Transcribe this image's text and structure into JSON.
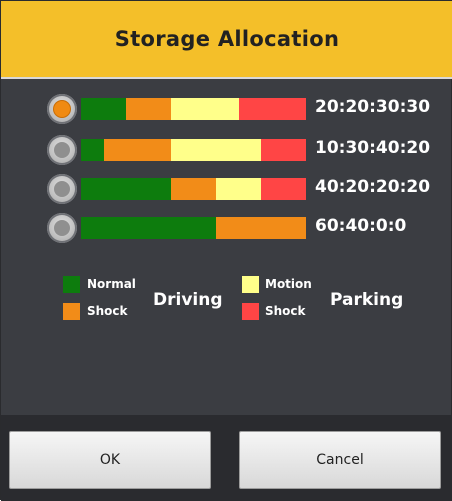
{
  "dialog": {
    "title": "Storage Allocation",
    "options": [
      {
        "ratio": "20:20:30:30",
        "selected": true,
        "segments": [
          {
            "percent": 20,
            "color": "#0d7c0d"
          },
          {
            "percent": 20,
            "color": "#f28c18"
          },
          {
            "percent": 30,
            "color": "#ffff8a"
          },
          {
            "percent": 30,
            "color": "#ff4545"
          }
        ]
      },
      {
        "ratio": "10:30:40:20",
        "selected": false,
        "segments": [
          {
            "percent": 10,
            "color": "#0d7c0d"
          },
          {
            "percent": 30,
            "color": "#f28c18"
          },
          {
            "percent": 40,
            "color": "#ffff8a"
          },
          {
            "percent": 20,
            "color": "#ff4545"
          }
        ]
      },
      {
        "ratio": "40:20:20:20",
        "selected": false,
        "segments": [
          {
            "percent": 40,
            "color": "#0d7c0d"
          },
          {
            "percent": 20,
            "color": "#f28c18"
          },
          {
            "percent": 20,
            "color": "#ffff8a"
          },
          {
            "percent": 20,
            "color": "#ff4545"
          }
        ]
      },
      {
        "ratio": "60:40:0:0",
        "selected": false,
        "segments": [
          {
            "percent": 60,
            "color": "#0d7c0d"
          },
          {
            "percent": 40,
            "color": "#f28c18"
          },
          {
            "percent": 0,
            "color": "#ffff8a"
          },
          {
            "percent": 0,
            "color": "#ff4545"
          }
        ]
      }
    ],
    "legend": {
      "driving_label": "Driving",
      "parking_label": "Parking",
      "driving_normal": "Normal",
      "driving_shock": "Shock",
      "parking_motion": "Motion",
      "parking_shock": "Shock",
      "colors": {
        "normal": "#0d7c0d",
        "driving_shock": "#f28c18",
        "motion": "#ffff8a",
        "parking_shock": "#ff4545"
      }
    },
    "buttons": {
      "ok": "OK",
      "cancel": "Cancel"
    }
  }
}
